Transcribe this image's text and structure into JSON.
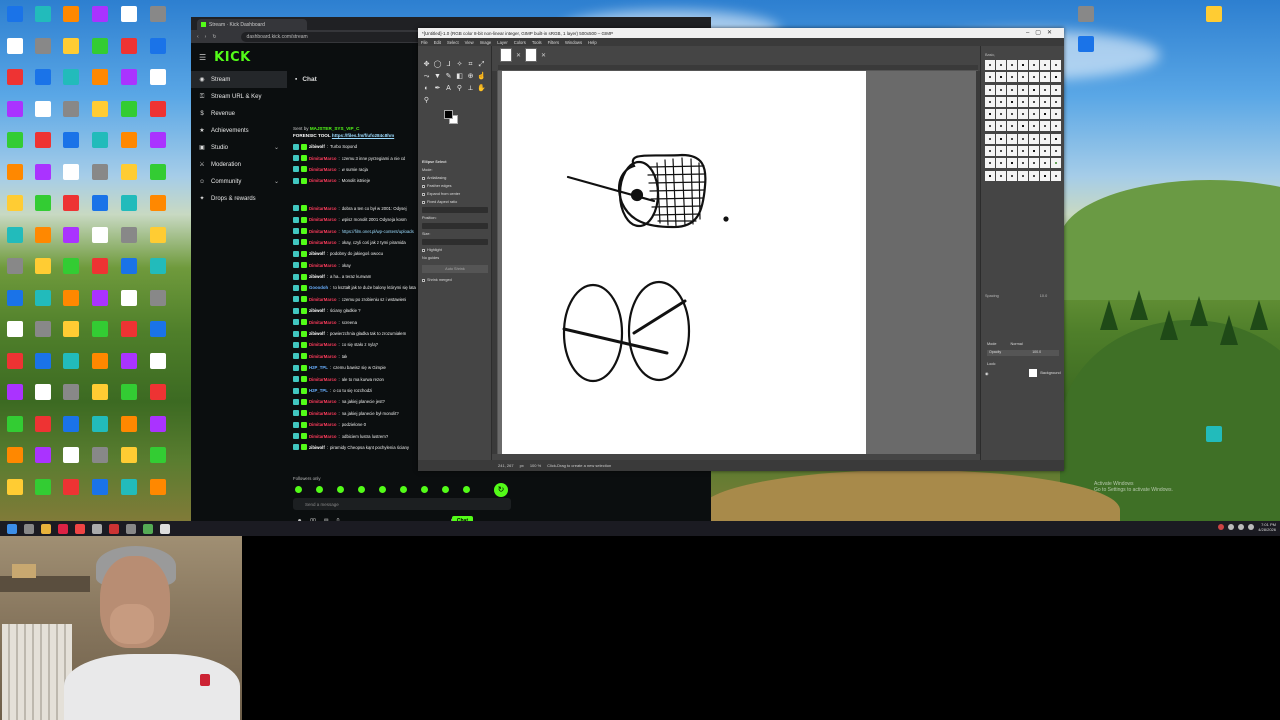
{
  "desktop": {
    "activate_line1": "Activate Windows",
    "activate_line2": "Go to Settings to activate Windows."
  },
  "kick": {
    "tab_title": "Stream · Kick Dashboard",
    "url": "dashboard.kick.com/stream",
    "logo": "KICK",
    "nav": [
      {
        "label": "Stream",
        "icon": "stream-icon",
        "glyph": "◉"
      },
      {
        "label": "Stream URL & Key",
        "icon": "key-icon",
        "glyph": "⚿"
      },
      {
        "label": "Revenue",
        "icon": "dollar-icon",
        "glyph": "$"
      },
      {
        "label": "Achievements",
        "icon": "trophy-icon",
        "glyph": "★"
      },
      {
        "label": "Studio",
        "icon": "studio-icon",
        "glyph": "▣"
      },
      {
        "label": "Moderation",
        "icon": "sword-icon",
        "glyph": "⚔"
      },
      {
        "label": "Community",
        "icon": "community-icon",
        "glyph": "☺"
      },
      {
        "label": "Drops & rewards",
        "icon": "gift-icon",
        "glyph": "✦"
      }
    ],
    "chat": {
      "title": "Chat",
      "sent_by_prefix": "Sent by",
      "sent_by_user": "MAJSTER_SYS_VIP_C",
      "forensic_label": "FORENSIC TOOL",
      "forensic_link": "https://files.fm/f/ufo284c8hm",
      "messages": [
        {
          "user": "zibiwolf",
          "text": "Turbo Sopond",
          "color": "#ffffff"
        },
        {
          "user": "DimitarMarco",
          "text": "czemu 3 inne pyrzegiami a nie cd",
          "color": "#ff3b5c"
        },
        {
          "user": "DimitarMarco",
          "text": "w sumie racja",
          "color": "#ff3b5c"
        },
        {
          "user": "DimitarMarco",
          "text": "Monolit istnieje",
          "color": "#ff3b5c"
        },
        {
          "user": "DimitarMarco",
          "text": "dobra a ten co był w 2001: Odysej",
          "color": "#ff3b5c"
        },
        {
          "user": "DimitarMarco",
          "text": "wpisz monolit 2001 Odyseja kosm",
          "color": "#ff3b5c"
        },
        {
          "user": "DimitarMarco",
          "text": "https://film.onet.pl/wp-content/uploads",
          "color": "#ff3b5c"
        },
        {
          "user": "DimitarMarco",
          "text": "okay, czyli coś jak z tymi piramida",
          "color": "#ff3b5c"
        },
        {
          "user": "zibiwolf",
          "text": "podobny do jakiegoś owocu",
          "color": "#ffffff"
        },
        {
          "user": "DimitarMarco",
          "text": "okay",
          "color": "#ff3b5c"
        },
        {
          "user": "zibiwolf",
          "text": "a ha.. a teraz kurwam",
          "color": "#ffffff"
        },
        {
          "user": "Gooodoh",
          "text": "to kształt jak te duże balony którymi się lata",
          "color": "#6ab0ff"
        },
        {
          "user": "DimitarMarco",
          "text": "czemu po zrobieniu sz i wstawieni",
          "color": "#ff3b5c"
        },
        {
          "user": "zibiwolf",
          "text": "ściany gładkie ?",
          "color": "#ffffff"
        },
        {
          "user": "DimitarMarco",
          "text": "screena",
          "color": "#ff3b5c"
        },
        {
          "user": "zibiwolf",
          "text": "powierzchnia gładka tak to zrozumiałem",
          "color": "#ffffff"
        },
        {
          "user": "DimitarMarco",
          "text": "co się stało z nylą?",
          "color": "#ff3b5c"
        },
        {
          "user": "DimitarMarco",
          "text": "tak",
          "color": "#ff3b5c"
        },
        {
          "user": "H2P_TPL",
          "text": "czemu bawisz się w Gimpie",
          "color": "#6ab0ff"
        },
        {
          "user": "DimitarMarco",
          "text": "ale to ma kurwa rezon",
          "color": "#ff3b5c"
        },
        {
          "user": "H2P_TPL",
          "text": "o co tu się rozchodzi",
          "color": "#6ab0ff"
        },
        {
          "user": "DimitarMarco",
          "text": "na jakiej planecie jest?",
          "color": "#ff3b5c"
        },
        {
          "user": "DimitarMarco",
          "text": "na jakiej planecie był monolit?",
          "color": "#ff3b5c"
        },
        {
          "user": "DimitarMarco",
          "text": "podzielone 0",
          "color": "#ff3b5c"
        },
        {
          "user": "DimitarMarco",
          "text": "odbiciem lustra lustrem?",
          "color": "#ff3b5c"
        },
        {
          "user": "zibiwolf",
          "text": "piramidy Cheopsa kąnt pochylenia ściany",
          "color": "#ffffff"
        }
      ],
      "followers_only": "Followers only",
      "placeholder": "Send a message",
      "viewers_count": "00",
      "queue_count": "0",
      "chat_button": "Chat"
    }
  },
  "gimp": {
    "title": "*[Untitled]-1.0 (RGB color 8-bit non-linear integer, GIMP built-in sRGB, 1 layer) 500x500 – GIMP",
    "menu": [
      "File",
      "Edit",
      "Select",
      "View",
      "Image",
      "Layer",
      "Colors",
      "Tools",
      "Filters",
      "Windows",
      "Help"
    ],
    "tool_options": {
      "title": "Ellipse Select",
      "mode_label": "Mode:",
      "antialiasing": "Antialiasing",
      "feather_edges": "Feather edges",
      "expand_from_center": "Expand from center",
      "fixed_aspect": "Fixed Aspect ratio",
      "position_label": "Position:",
      "size_label": "Size:",
      "highlight": "Highlight",
      "guides": "No guides",
      "auto_shrink": "Auto Shrink",
      "shrink_merged": "Shrink merged"
    },
    "status": {
      "coords": "241, 267",
      "unit": "px",
      "zoom": "100 %",
      "hint": "Click-Drag to create a new selection"
    },
    "dock": {
      "brushes_label": "Basic,",
      "spacing_label": "Spacing",
      "spacing_value": "10.0",
      "mode_label": "Mode",
      "mode_value": "Normal",
      "opacity_label": "Opacity",
      "opacity_value": "100.0",
      "lock_label": "Lock:",
      "layer_name": "Background"
    }
  },
  "clock": {
    "time": "7:01 PM",
    "date": "4/28/2026"
  }
}
